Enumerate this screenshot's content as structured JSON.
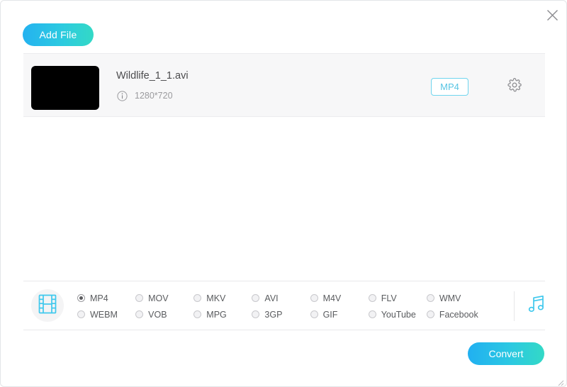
{
  "window": {
    "close_icon": "close-icon",
    "resize_grip": "resize-grip"
  },
  "toolbar": {
    "add_file_label": "Add File"
  },
  "file_list": {
    "items": [
      {
        "name": "Wildlife_1_1.avi",
        "info_icon": "info-icon",
        "resolution": "1280*720",
        "output_format": "MP4",
        "settings_icon": "gear-icon",
        "thumbnail": "video-thumbnail"
      }
    ]
  },
  "format_bar": {
    "video_icon": "film-strip-icon",
    "audio_icon": "music-note-icon",
    "selected_format": "MP4",
    "options": [
      {
        "label": "MP4",
        "selected": true
      },
      {
        "label": "WEBM",
        "selected": false
      },
      {
        "label": "MOV",
        "selected": false
      },
      {
        "label": "VOB",
        "selected": false
      },
      {
        "label": "MKV",
        "selected": false
      },
      {
        "label": "MPG",
        "selected": false
      },
      {
        "label": "AVI",
        "selected": false
      },
      {
        "label": "3GP",
        "selected": false
      },
      {
        "label": "M4V",
        "selected": false
      },
      {
        "label": "GIF",
        "selected": false
      },
      {
        "label": "FLV",
        "selected": false
      },
      {
        "label": "YouTube",
        "selected": false
      },
      {
        "label": "WMV",
        "selected": false
      },
      {
        "label": "Facebook",
        "selected": false
      }
    ]
  },
  "footer": {
    "convert_label": "Convert"
  },
  "colors": {
    "accent_start": "#21b0f1",
    "accent_end": "#33d9c6",
    "badge_border": "#6fd5ee",
    "badge_text": "#57c4e3",
    "panel_bg": "#f7f7f8"
  }
}
